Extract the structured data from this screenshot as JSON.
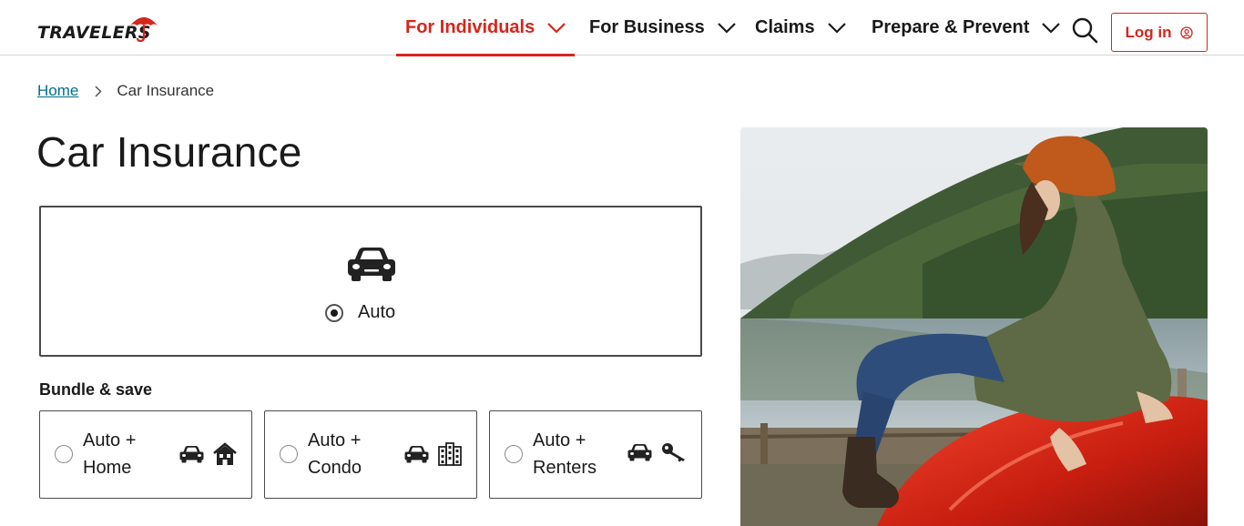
{
  "brand": {
    "logo_text": "TRAVELERS",
    "accent_color": "#d6261c",
    "link_color": "#006f8e"
  },
  "header": {
    "nav": [
      {
        "label": "For Individuals",
        "active": true
      },
      {
        "label": "For Business",
        "active": false
      },
      {
        "label": "Claims",
        "active": false
      },
      {
        "label": "Prepare & Prevent",
        "active": false
      }
    ],
    "search_icon": "search-icon",
    "login_label": "Log in",
    "login_icon": "user-circle-icon"
  },
  "breadcrumb": {
    "home": "Home",
    "current": "Car Insurance"
  },
  "page": {
    "title": "Car Insurance"
  },
  "auto_option": {
    "label": "Auto",
    "icon": "car-icon",
    "selected": true
  },
  "bundle": {
    "title": "Bundle & save",
    "options": [
      {
        "line1": "Auto +",
        "line2": "Home",
        "icons": [
          "car-icon",
          "house-icon"
        ],
        "selected": false
      },
      {
        "line1": "Auto +",
        "line2": "Condo",
        "icons": [
          "car-icon",
          "condo-building-icon"
        ],
        "selected": false
      },
      {
        "line1": "Auto +",
        "line2": "Renters",
        "icons": [
          "car-icon",
          "key-icon"
        ],
        "selected": false
      }
    ]
  }
}
